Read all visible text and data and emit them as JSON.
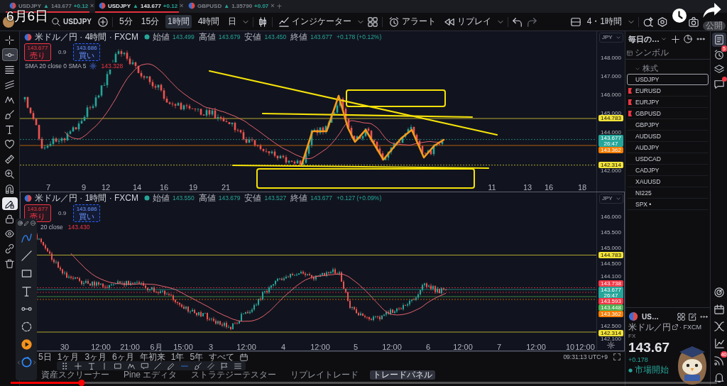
{
  "caption": "6月6日",
  "tabs": [
    {
      "symbol": "USDJPY",
      "arrow": "▲",
      "price": "143.677",
      "change": "+0.12",
      "close": "×",
      "selected": false,
      "underlined": true
    },
    {
      "symbol": "USDJPY",
      "arrow": "▲",
      "price": "143.677",
      "change": "+0.12",
      "close": "×",
      "selected": true,
      "underlined": true
    },
    {
      "symbol": "GBPUSD",
      "arrow": "▲",
      "price": "1.35790",
      "change": "+0.07",
      "close": "×",
      "selected": false,
      "underlined": false
    }
  ],
  "new_tab": "+",
  "toolbar": {
    "symbol": "USDJPY",
    "intervals": [
      {
        "label": "5分",
        "selected": false
      },
      {
        "label": "15分",
        "selected": false
      },
      {
        "label": "1時間",
        "selected": true
      },
      {
        "label": "4時間",
        "selected": false
      },
      {
        "label": "日",
        "selected": false
      }
    ],
    "indicators": "インジケーター",
    "alert": "アラート",
    "replay": "リプレイ",
    "layout": "4・1時間",
    "publish": "公開"
  },
  "left_tools": [
    {
      "selected": false,
      "active": false
    },
    {
      "selected": true,
      "active": false
    },
    {
      "selected": false,
      "active": false
    },
    {
      "selected": false,
      "active": false
    },
    {
      "selected": false,
      "active": false
    },
    {
      "selected": false,
      "active": false
    },
    {
      "selected": false,
      "active": false
    },
    {
      "selected": false,
      "active": false
    },
    {
      "selected": false,
      "active": false
    },
    {
      "selected": false,
      "active": false
    },
    {
      "selected": false,
      "active": false
    },
    {
      "selected": false,
      "active": true
    },
    {
      "selected": false,
      "active": false
    },
    {
      "selected": false,
      "active": false
    },
    {
      "selected": false,
      "active": false
    },
    {
      "selected": false,
      "active": false
    }
  ],
  "charts": [
    {
      "title": "米ドル／円 · 4時間 · FXCM",
      "ohlc": [
        {
          "label": "始値",
          "value": "143.499"
        },
        {
          "label": "高値",
          "value": "143.679"
        },
        {
          "label": "安値",
          "value": "143.450"
        },
        {
          "label": "終値",
          "value": "143.677"
        }
      ],
      "change": "+0.178 (+0.12%)",
      "sell": {
        "price": "143.677",
        "label": "売り"
      },
      "spread": "0.9",
      "buy": {
        "price": "143.686",
        "label": "買い"
      },
      "indicator": {
        "name": "SMA 20 close 0 SMA 5",
        "value": "143.328"
      },
      "currency": "JPY",
      "axis_ticks": [
        "148.000",
        "147.000",
        "146.000",
        "145.000",
        "144.000",
        "142.000"
      ],
      "price_labels": [
        {
          "price": "144.783",
          "color": "#f2e33a"
        },
        {
          "price": "143.677",
          "timer": "26:47",
          "color": "#26a69a"
        },
        {
          "price": "143.362",
          "color": "#f57c00"
        },
        {
          "price": "142.314",
          "color": "#f2e33a"
        }
      ],
      "time_labels": [
        "7",
        "9",
        "12",
        "14",
        "16",
        "19",
        "21",
        "11",
        "13",
        "16",
        "18"
      ],
      "selected": false
    },
    {
      "title": "米ドル／円 · 1時間 · FXCM",
      "ohlc": [
        {
          "label": "始値",
          "value": "143.550"
        },
        {
          "label": "高値",
          "value": "143.679"
        },
        {
          "label": "安値",
          "value": "143.527"
        },
        {
          "label": "終値",
          "value": "143.677"
        }
      ],
      "change": "+0.127 (+0.09%)",
      "sell": {
        "price": "143.677",
        "label": "売り"
      },
      "spread": "0.9",
      "buy": {
        "price": "143.686",
        "label": "買い"
      },
      "indicator": {
        "name": "20 close",
        "value": "143.430"
      },
      "currency": "JPY",
      "axis_ticks": [
        "146.000",
        "145.500",
        "145.000",
        "144.500",
        "144.100",
        "142.500",
        "142.100"
      ],
      "price_labels": [
        {
          "price": "144.783",
          "color": "#f2e33a"
        },
        {
          "price": "143.738",
          "color": "#f23645"
        },
        {
          "price": "143.677",
          "timer": "26:47",
          "color": "#26a69a"
        },
        {
          "price": "143.593",
          "color": "#f23645"
        },
        {
          "price": "143.448",
          "color": "#4caf50"
        },
        {
          "price": "143.362",
          "color": "#f57c00"
        },
        {
          "price": "142.314",
          "color": "#f2e33a"
        }
      ],
      "time_labels": [
        "30",
        "12:00",
        "21:00",
        "6月",
        "15:00",
        "3",
        "12:00",
        "4",
        "12:00",
        "5",
        "12:00",
        "6",
        "12:00",
        "7",
        "12:00",
        "10",
        "12:00"
      ],
      "selected": true
    }
  ],
  "ranges": [
    "5日",
    "1ヶ月",
    "3ヶ月",
    "6ヶ月",
    "年初来",
    "1年",
    "5年",
    "すべて"
  ],
  "clock": "09:31:13 UTC+9",
  "panels": [
    {
      "label": "資産スクリーナー",
      "selected": false
    },
    {
      "label": "Pine エディタ",
      "selected": false
    },
    {
      "label": "ストラテジーテスター",
      "selected": false
    },
    {
      "label": "リプレイトレード",
      "selected": false
    },
    {
      "label": "トレードパネル",
      "selected": true
    }
  ],
  "watchlist": {
    "title": "毎日の…",
    "column": "シンボル",
    "section": "株式",
    "symbols": [
      {
        "symbol": "USDJPY",
        "selected": true,
        "flagged": false
      },
      {
        "symbol": "EURUSD",
        "selected": false,
        "flagged": true
      },
      {
        "symbol": "EURJPY",
        "selected": false,
        "flagged": true
      },
      {
        "symbol": "GBPUSD",
        "selected": false,
        "flagged": true
      },
      {
        "symbol": "GBPJPY",
        "selected": false,
        "flagged": false
      },
      {
        "symbol": "AUDUSD",
        "selected": false,
        "flagged": false
      },
      {
        "symbol": "AUDJPY",
        "selected": false,
        "flagged": false
      },
      {
        "symbol": "USDCAD",
        "selected": false,
        "flagged": false
      },
      {
        "symbol": "CADJPY",
        "selected": false,
        "flagged": false
      },
      {
        "symbol": "XAUUSD",
        "selected": false,
        "flagged": false
      },
      {
        "symbol": "NI225",
        "selected": false,
        "flagged": false
      },
      {
        "symbol": "SPX •",
        "selected": false,
        "flagged": false
      }
    ]
  },
  "details": {
    "symbol": "US…",
    "name": "米ドル／円",
    "exchange": "· FXCM",
    "type": "FX",
    "price": "143.67",
    "change": "+0.178",
    "status": "市場開始"
  },
  "right_bar": [
    {
      "selected": true,
      "notified": false
    },
    {
      "selected": false,
      "notified": false,
      "badge": "5"
    },
    {
      "selected": false,
      "notified": false
    },
    {
      "selected": false,
      "notified": true
    },
    {
      "selected": false,
      "notified": false
    },
    {
      "selected": false,
      "notified": false
    },
    {
      "selected": false,
      "notified": false
    },
    {
      "selected": false,
      "notified": false
    },
    {
      "selected": false,
      "notified": false,
      "badge": "40"
    },
    {
      "selected": false,
      "notified": false
    }
  ],
  "video": {
    "progress": {
      "level": 0.1
    }
  }
}
